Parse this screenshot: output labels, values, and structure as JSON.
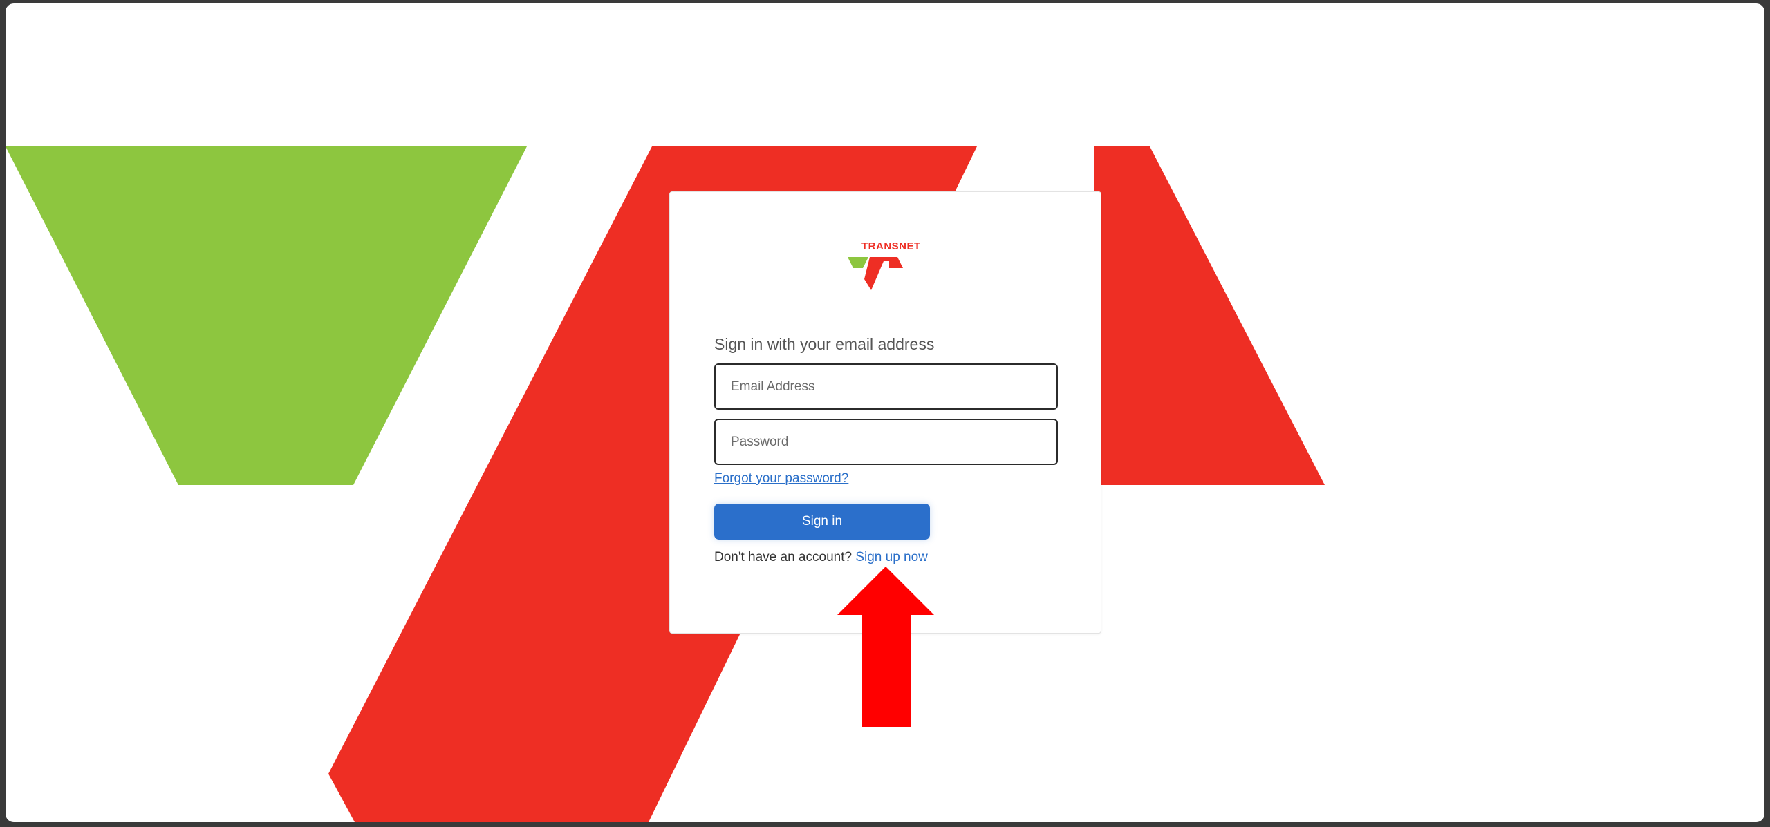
{
  "brand": {
    "logo_text": "TRANSNET",
    "primary_color": "#ee2e24",
    "secondary_color": "#8dc63f"
  },
  "login": {
    "heading": "Sign in with your email address",
    "email_placeholder": "Email Address",
    "password_placeholder": "Password",
    "forgot_password": "Forgot your password?",
    "sign_in_label": "Sign in",
    "no_account_text": "Don't have an account?",
    "sign_up_link": "Sign up now",
    "button_color": "#2b6fcb",
    "link_color": "#2a6fc9"
  },
  "annotation": {
    "icon": "arrow-up-icon",
    "color": "#ff0000"
  }
}
